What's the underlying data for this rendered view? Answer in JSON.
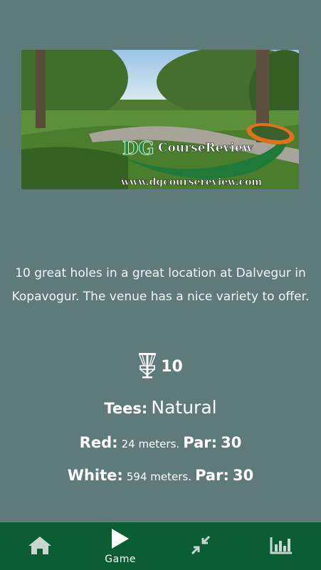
{
  "banner": {
    "brand_dg": "DG",
    "brand_text": "CourseReview",
    "url": "www.dgcoursereview.com"
  },
  "description": "10 great holes in a great location at Dalvegur in Kopavogur. The venue has a nice variety to offer.",
  "holes": {
    "icon": "disc-golf-basket-icon",
    "count": "10"
  },
  "tees": {
    "label": "Tees:",
    "value": "Natural"
  },
  "tee_lines": [
    {
      "color": "Red:",
      "distance": "24 meters.",
      "par_label": "Par:",
      "par": "30"
    },
    {
      "color": "White:",
      "distance": "594 meters.",
      "par_label": "Par:",
      "par": "30"
    }
  ],
  "navbar": {
    "background": "#0b5e33",
    "items": [
      {
        "icon": "home-icon",
        "label": ""
      },
      {
        "icon": "play-icon",
        "label": "Game"
      },
      {
        "icon": "compress-icon",
        "label": ""
      },
      {
        "icon": "chart-icon",
        "label": ""
      }
    ]
  }
}
